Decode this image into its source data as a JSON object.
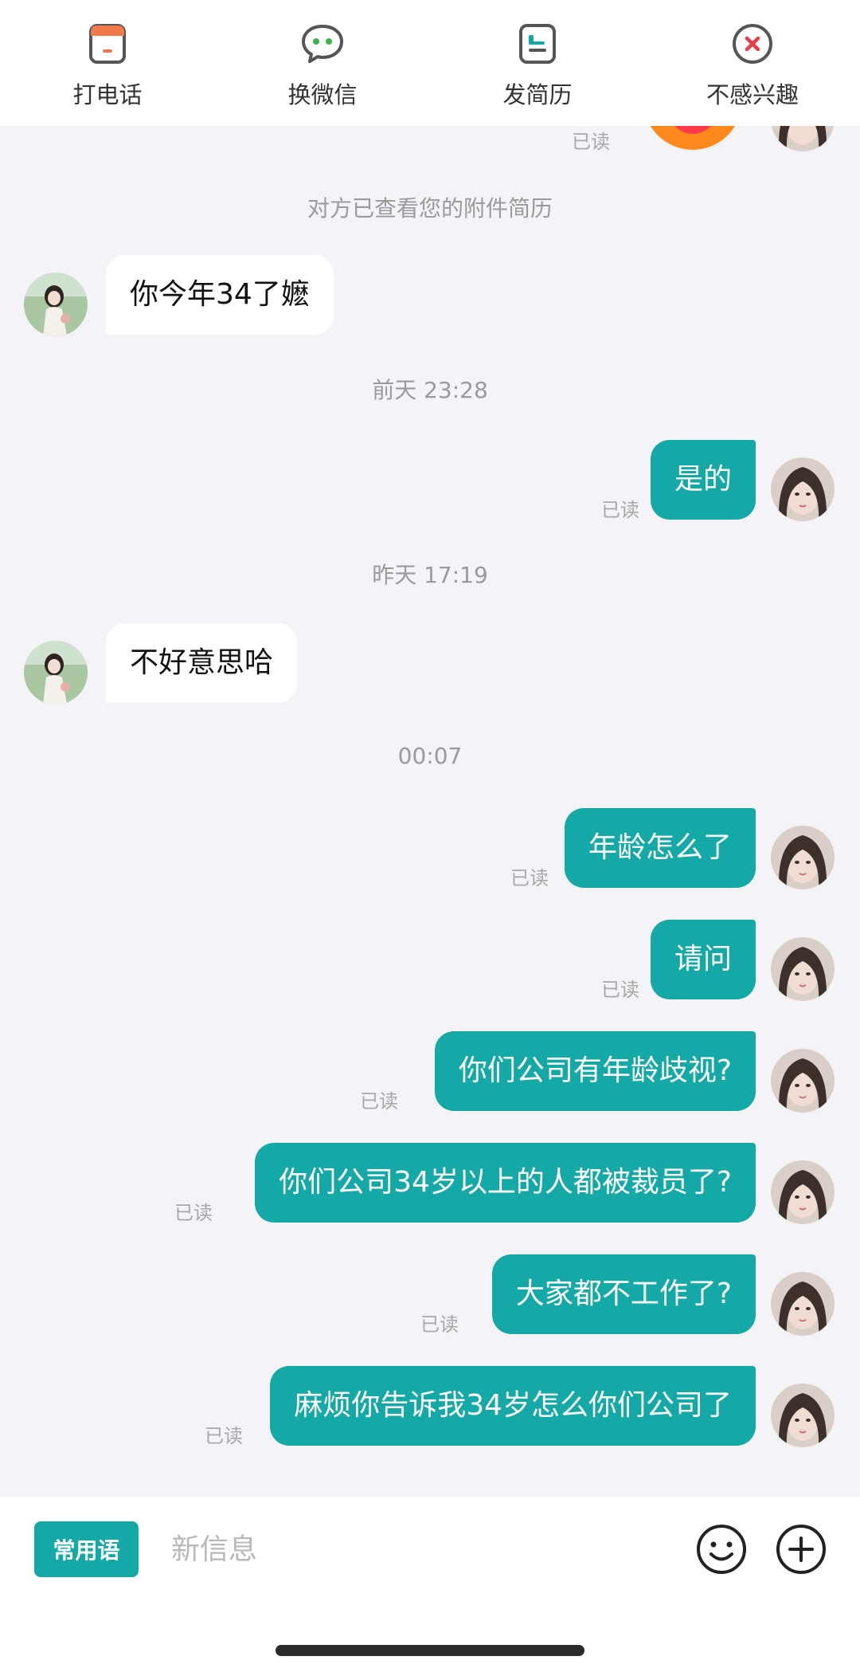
{
  "actions": [
    {
      "label": "打电话",
      "icon": "phone-icon",
      "color": "#f07a4a"
    },
    {
      "label": "换微信",
      "icon": "wechat-icon",
      "color": "#3bb44a"
    },
    {
      "label": "发简历",
      "icon": "resume-icon",
      "color": "#14a9a6"
    },
    {
      "label": "不感兴趣",
      "icon": "not-interested-icon",
      "color": "#e5404a"
    }
  ],
  "chat": {
    "top_read": "已读",
    "notice": "对方已查看您的附件简历",
    "messages": [
      {
        "side": "in",
        "text": "你今年34了嬷"
      },
      {
        "time": "前天 23:28"
      },
      {
        "side": "out",
        "text": "是的",
        "status": "已读"
      },
      {
        "time": "昨天 17:19"
      },
      {
        "side": "in",
        "text": "不好意思哈"
      },
      {
        "time": "00:07"
      },
      {
        "side": "out",
        "text": "年龄怎么了",
        "status": "已读"
      },
      {
        "side": "out",
        "text": "请问",
        "status": "已读"
      },
      {
        "side": "out",
        "text": "你们公司有年龄歧视?",
        "status": "已读"
      },
      {
        "side": "out",
        "text": "你们公司34岁以上的人都被裁员了?",
        "status": "已读"
      },
      {
        "side": "out",
        "text": "大家都不工作了?",
        "status": "已读"
      },
      {
        "side": "out",
        "text": "麻烦你告诉我34岁怎么你们公司了",
        "status": "已读"
      }
    ]
  },
  "input": {
    "phrase_button": "常用语",
    "placeholder": "新信息",
    "emoji_icon": "smiley-icon",
    "add_icon": "plus-circle-icon"
  },
  "colors": {
    "accent": "#14a9a6",
    "background": "#f4f4f8",
    "bubble_in": "#ffffff"
  }
}
